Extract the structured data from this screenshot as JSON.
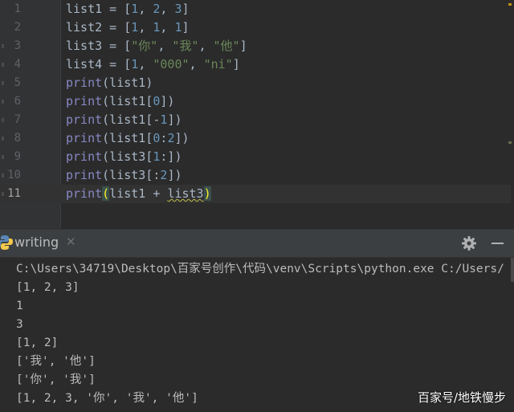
{
  "editor": {
    "lines": [
      {
        "num": "1",
        "code": [
          {
            "t": "list1 = [",
            "c": ""
          },
          {
            "t": "1",
            "c": "num"
          },
          {
            "t": ", ",
            "c": ""
          },
          {
            "t": "2",
            "c": "num"
          },
          {
            "t": ", ",
            "c": ""
          },
          {
            "t": "3",
            "c": "num"
          },
          {
            "t": "]",
            "c": ""
          }
        ]
      },
      {
        "num": "2",
        "code": [
          {
            "t": "list2 = [",
            "c": ""
          },
          {
            "t": "1",
            "c": "num"
          },
          {
            "t": ", ",
            "c": ""
          },
          {
            "t": "1",
            "c": "num"
          },
          {
            "t": ", ",
            "c": ""
          },
          {
            "t": "1",
            "c": "num"
          },
          {
            "t": "]",
            "c": ""
          }
        ]
      },
      {
        "num": "3",
        "code": [
          {
            "t": "list3 = [",
            "c": ""
          },
          {
            "t": "\"你\"",
            "c": "str"
          },
          {
            "t": ", ",
            "c": ""
          },
          {
            "t": "\"我\"",
            "c": "str"
          },
          {
            "t": ", ",
            "c": ""
          },
          {
            "t": "\"他\"",
            "c": "str"
          },
          {
            "t": "]",
            "c": ""
          }
        ]
      },
      {
        "num": "4",
        "code": [
          {
            "t": "list4 = [",
            "c": ""
          },
          {
            "t": "1",
            "c": "num"
          },
          {
            "t": ", ",
            "c": ""
          },
          {
            "t": "\"000\"",
            "c": "str"
          },
          {
            "t": ", ",
            "c": ""
          },
          {
            "t": "\"ni\"",
            "c": "str"
          },
          {
            "t": "]",
            "c": ""
          }
        ]
      },
      {
        "num": "5",
        "code": [
          {
            "t": "print",
            "c": "kw"
          },
          {
            "t": "(list1)",
            "c": ""
          }
        ]
      },
      {
        "num": "6",
        "code": [
          {
            "t": "print",
            "c": "kw"
          },
          {
            "t": "(list1[",
            "c": ""
          },
          {
            "t": "0",
            "c": "num"
          },
          {
            "t": "])",
            "c": ""
          }
        ]
      },
      {
        "num": "7",
        "code": [
          {
            "t": "print",
            "c": "kw"
          },
          {
            "t": "(list1[-",
            "c": ""
          },
          {
            "t": "1",
            "c": "num"
          },
          {
            "t": "])",
            "c": ""
          }
        ]
      },
      {
        "num": "8",
        "code": [
          {
            "t": "print",
            "c": "kw"
          },
          {
            "t": "(list1[",
            "c": ""
          },
          {
            "t": "0",
            "c": "num"
          },
          {
            "t": ":",
            "c": ""
          },
          {
            "t": "2",
            "c": "num"
          },
          {
            "t": "])",
            "c": ""
          }
        ]
      },
      {
        "num": "9",
        "code": [
          {
            "t": "print",
            "c": "kw"
          },
          {
            "t": "(list3[",
            "c": ""
          },
          {
            "t": "1",
            "c": "num"
          },
          {
            "t": ":])",
            "c": ""
          }
        ]
      },
      {
        "num": "10",
        "code": [
          {
            "t": "print",
            "c": "kw"
          },
          {
            "t": "(list3[:",
            "c": ""
          },
          {
            "t": "2",
            "c": "num"
          },
          {
            "t": "])",
            "c": ""
          }
        ]
      },
      {
        "num": "11",
        "code": [
          {
            "t": "print",
            "c": "kw"
          },
          {
            "t": "(",
            "c": "paren-hl"
          },
          {
            "t": "list1 + ",
            "c": ""
          },
          {
            "t": "list3",
            "c": "squiggle"
          },
          {
            "t": ")",
            "c": "paren-hl"
          }
        ]
      }
    ]
  },
  "run_panel": {
    "tab_label": "writing",
    "close_glyph": "✕",
    "output": [
      "C:\\Users\\34719\\Desktop\\百家号创作\\代码\\venv\\Scripts\\python.exe C:/Users/",
      "[1, 2, 3]",
      "1",
      "3",
      "[1, 2]",
      "['我', '他']",
      "['你', '我']",
      "[1, 2, 3, '你', '我', '他']"
    ]
  },
  "watermark": "百家号/地铁慢步",
  "colors": {
    "keyword": "#8888c6",
    "number": "#6897bb",
    "string": "#6a8759",
    "default": "#a9b7c6"
  }
}
